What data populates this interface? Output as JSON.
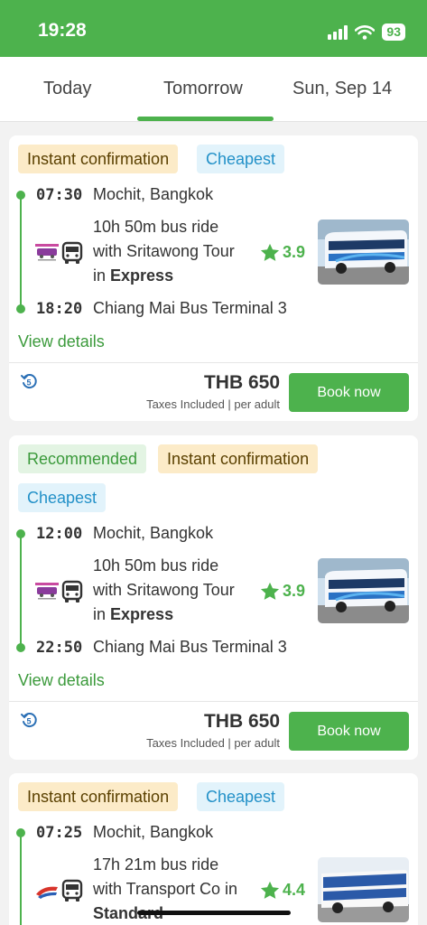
{
  "status_bar": {
    "time": "19:28",
    "battery": "93"
  },
  "tabs": [
    {
      "label": "Today"
    },
    {
      "label": "Tomorrow",
      "active": true
    },
    {
      "label": "Sun, Sep 14"
    }
  ],
  "trips": [
    {
      "badges": [
        "Instant confirmation",
        "Cheapest"
      ],
      "departure_time": "07:30",
      "departure_place": "Mochit, Bangkok",
      "duration": "10h 50m bus ride",
      "operator_line": "with Sritawong Tour",
      "class_prefix": "in",
      "class": "Express",
      "rating": "3.9",
      "arrival_time": "18:20",
      "arrival_place": "Chiang Mai Bus Terminal 3",
      "view_details": "View details",
      "price": "THB 650",
      "price_note": "Taxes Included | per adult",
      "book_label": "Book now"
    },
    {
      "badges": [
        "Recommended",
        "Instant confirmation",
        "Cheapest"
      ],
      "departure_time": "12:00",
      "departure_place": "Mochit, Bangkok",
      "duration": "10h 50m bus ride",
      "operator_line": "with Sritawong Tour",
      "class_prefix": "in",
      "class": "Express",
      "rating": "3.9",
      "arrival_time": "22:50",
      "arrival_place": "Chiang Mai Bus Terminal 3",
      "view_details": "View details",
      "price": "THB 650",
      "price_note": "Taxes Included | per adult",
      "book_label": "Book now"
    },
    {
      "badges": [
        "Instant confirmation",
        "Cheapest"
      ],
      "departure_time": "07:25",
      "departure_place": "Mochit, Bangkok",
      "duration": "17h 21m bus ride",
      "operator_line": "with Transport Co in",
      "class_prefix": "",
      "class": "Standard",
      "rating": "4.4"
    }
  ],
  "colors": {
    "brand_green": "#4db24d",
    "cheapest_blue": "#2391c8",
    "instant_bg": "#fcebc8"
  }
}
